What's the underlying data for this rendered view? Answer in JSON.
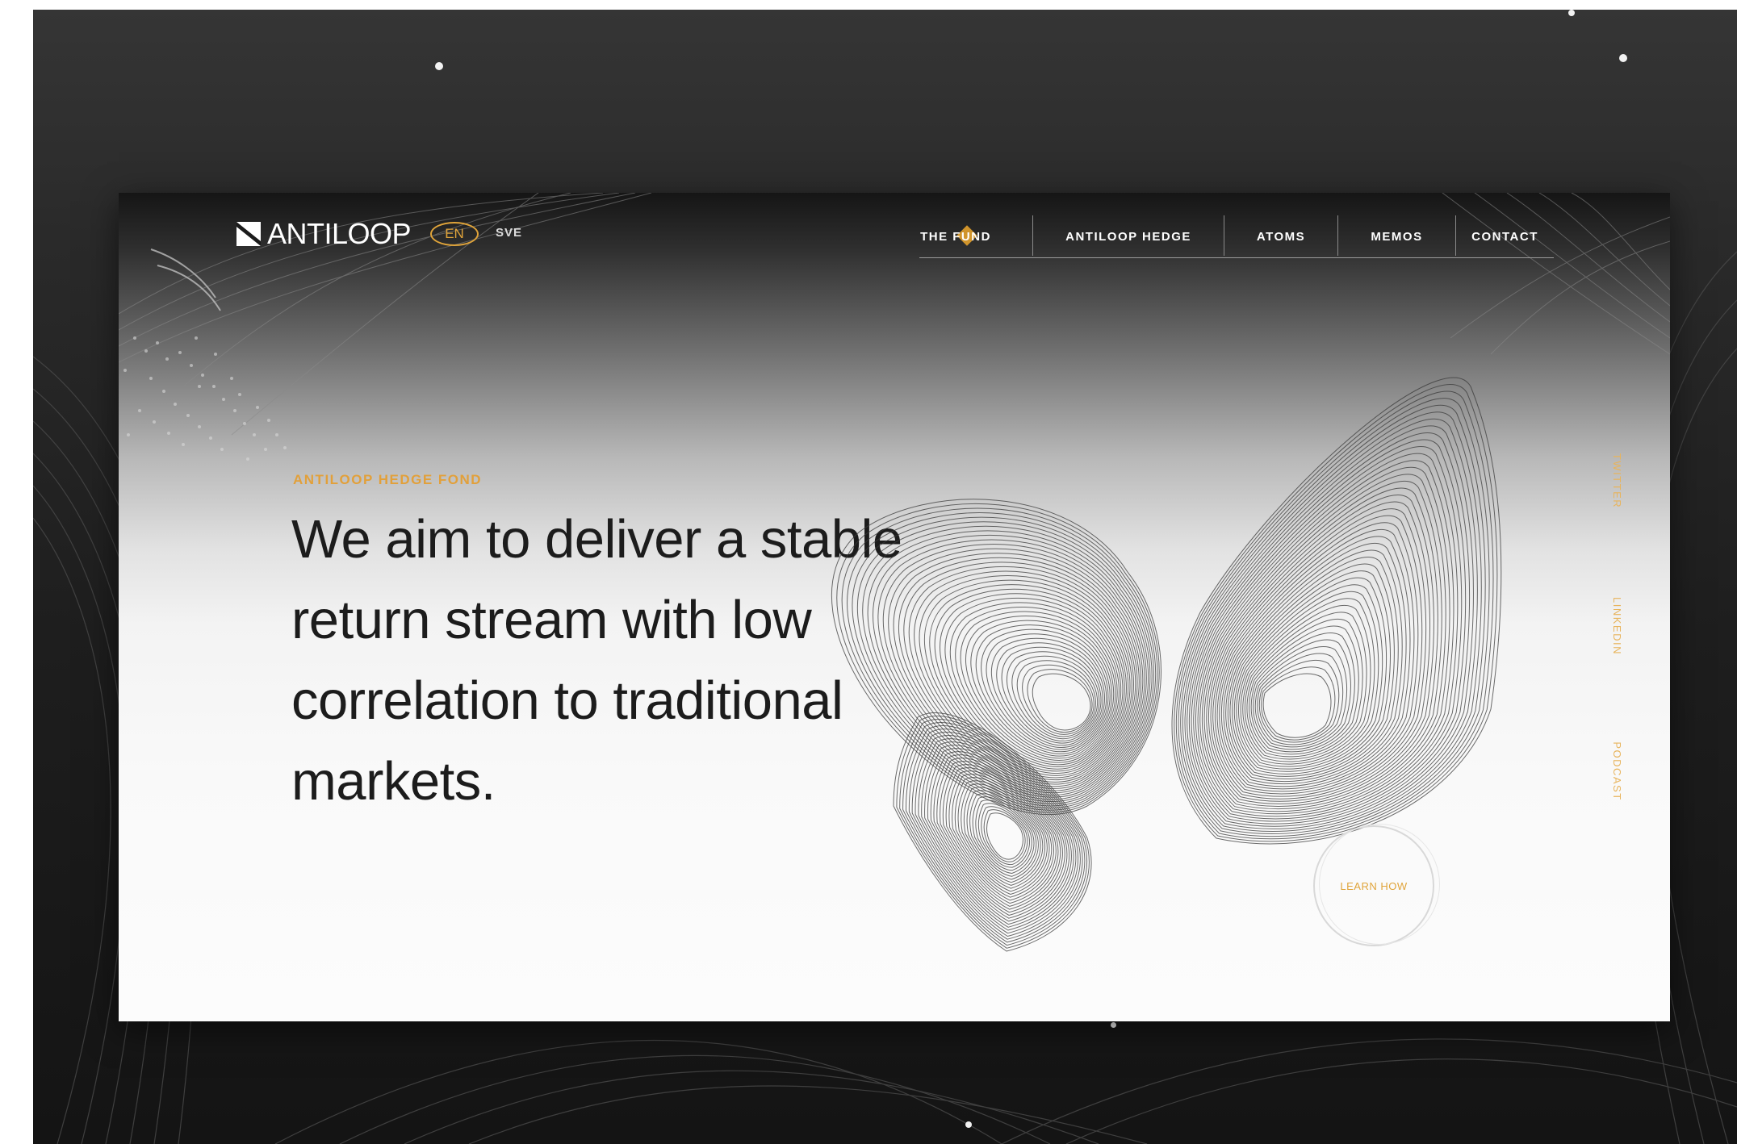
{
  "brand": {
    "name": "ANTILOOP",
    "accent_color": "#e0a43a"
  },
  "languages": {
    "active": "EN",
    "other": "SVE"
  },
  "nav": {
    "items": [
      {
        "label": "THE FUND"
      },
      {
        "label": "ANTILOOP HEDGE"
      },
      {
        "label": "ATOMS"
      },
      {
        "label": "MEMOS"
      },
      {
        "label": "CONTACT"
      }
    ]
  },
  "hero": {
    "eyebrow": "ANTILOOP HEDGE FOND",
    "headline": "We aim to deliver a stable return stream with low correlation to traditional markets.",
    "cta": "LEARN HOW"
  },
  "social": {
    "items": [
      {
        "label": "TWITTER"
      },
      {
        "label": "LINKEDIN"
      },
      {
        "label": "PODCAST"
      }
    ]
  }
}
